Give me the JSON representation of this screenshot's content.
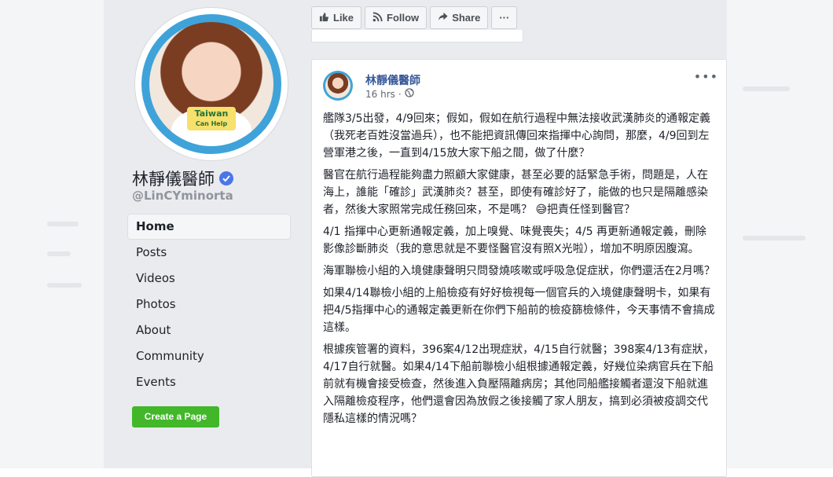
{
  "page": {
    "name": "林靜儀醫師",
    "handle": "@LinCYminorta",
    "avatar_badge": {
      "line1": "Taiwan",
      "line2": "Can Help"
    }
  },
  "nav": {
    "items": [
      {
        "label": "Home",
        "active": true
      },
      {
        "label": "Posts",
        "active": false
      },
      {
        "label": "Videos",
        "active": false
      },
      {
        "label": "Photos",
        "active": false
      },
      {
        "label": "About",
        "active": false
      },
      {
        "label": "Community",
        "active": false
      },
      {
        "label": "Events",
        "active": false
      }
    ],
    "create_page_label": "Create a Page"
  },
  "actions": {
    "like_label": "Like",
    "follow_label": "Follow",
    "share_label": "Share",
    "more_label": "···"
  },
  "post": {
    "author": "林靜儀醫師",
    "time": "16 hrs",
    "more_label": "•••",
    "paragraphs": [
      "艦隊3/5出發，4/9回來；假如，假如在航行過程中無法接收武漢肺炎的通報定義（我死老百姓沒當過兵），也不能把資訊傳回來指揮中心詢問，那麼，4/9回到左營軍港之後，一直到4/15放大家下船之間，做了什麼？",
      "醫官在航行過程能夠盡力照顧大家健康，甚至必要的話緊急手術，問題是，人在海上，誰能「確診」武漢肺炎？甚至，即使有確診好了，能做的也只是隔離感染者，然後大家照常完成任務回來，不是嗎？ 😅把責任怪到醫官？",
      "4/1 指揮中心更新通報定義，加上嗅覺、味覺喪失；4/5 再更新通報定義，刪除影像診斷肺炎（我的意思就是不要怪醫官沒有照X光啦），增加不明原因腹瀉。",
      "海軍聯檢小組的入境健康聲明只問發燒咳嗽或呼吸急促症狀，你們還活在2月嗎？",
      "如果4/14聯檢小組的上船檢疫有好好檢視每一個官兵的入境健康聲明卡，如果有把4/5指揮中心的通報定義更新在你們下船前的檢疫篩檢條件，今天事情不會搞成這樣。",
      "根據疾管署的資料，396案4/12出現症狀，4/15自行就醫；398案4/13有症狀，4/17自行就醫。如果4/14下船前聯檢小組根據通報定義，好幾位染病官兵在下船前就有機會接受檢查，然後進入負壓隔離病房；其他同船艦接觸者還沒下船就進入隔離檢疫程序，他們還會因為放假之後接觸了家人朋友，搞到必須被疫調交代隱私這樣的情況嗎？"
    ]
  },
  "colors": {
    "link_blue": "#365899",
    "verified_blue": "#4a76e8",
    "create_green": "#42b72a",
    "sidebar_bg": "#e9ebee"
  }
}
